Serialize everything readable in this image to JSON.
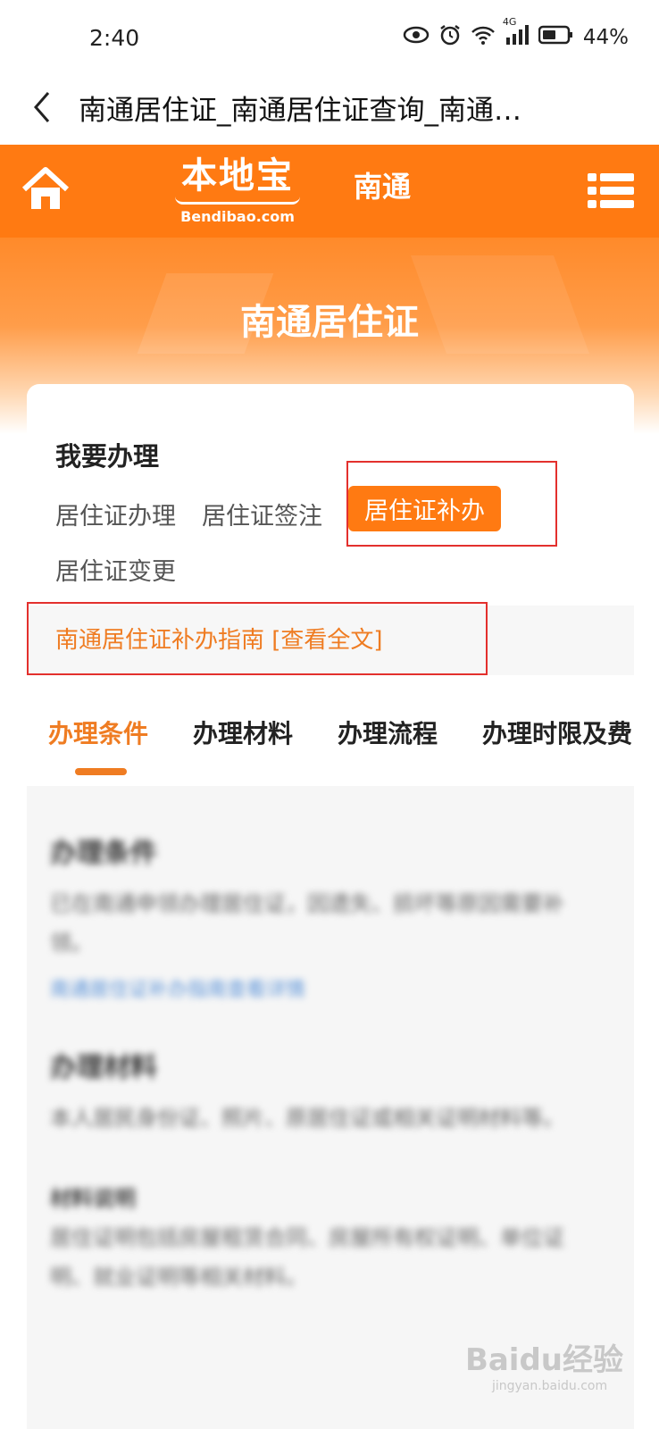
{
  "status": {
    "time": "2:40",
    "battery": "44%",
    "network": "4G",
    "icons": [
      "eye-icon",
      "alarm-icon",
      "wifi-icon",
      "signal-icon",
      "battery-icon"
    ]
  },
  "browser": {
    "title": "南通居住证_南通居住证查询_南通…"
  },
  "header": {
    "logo_cn": "本地宝",
    "logo_en": "Bendibao.com",
    "city": "南通",
    "accent": "#ff7a12"
  },
  "banner": {
    "title": "南通居住证"
  },
  "service": {
    "section_title": "我要办理",
    "options": [
      "居住证办理",
      "居住证签注",
      "居住证补办",
      "居住证变更"
    ],
    "active_option": "居住证补办",
    "guide_link": "南通居住证补办指南 [查看全文]"
  },
  "tabs": [
    "办理条件",
    "办理材料",
    "办理流程",
    "办理时限及费"
  ],
  "content": {
    "section1_title": "办理条件",
    "section1_text": "已在南通申领办理居住证，因遗失、损坏等原因需要补领。",
    "section1_link": "南通居住证补办指南查看详情",
    "section2_title": "办理材料",
    "section2_text": "本人居民身份证、照片、原居住证或相关证明材料等。",
    "section2_sub": "材料说明",
    "section2_more": "居住证明包括房屋租赁合同、房屋所有权证明、单位证明、就业证明等相关材料。"
  },
  "watermark": {
    "brand": "Baidu经验",
    "url": "jingyan.baidu.com"
  }
}
